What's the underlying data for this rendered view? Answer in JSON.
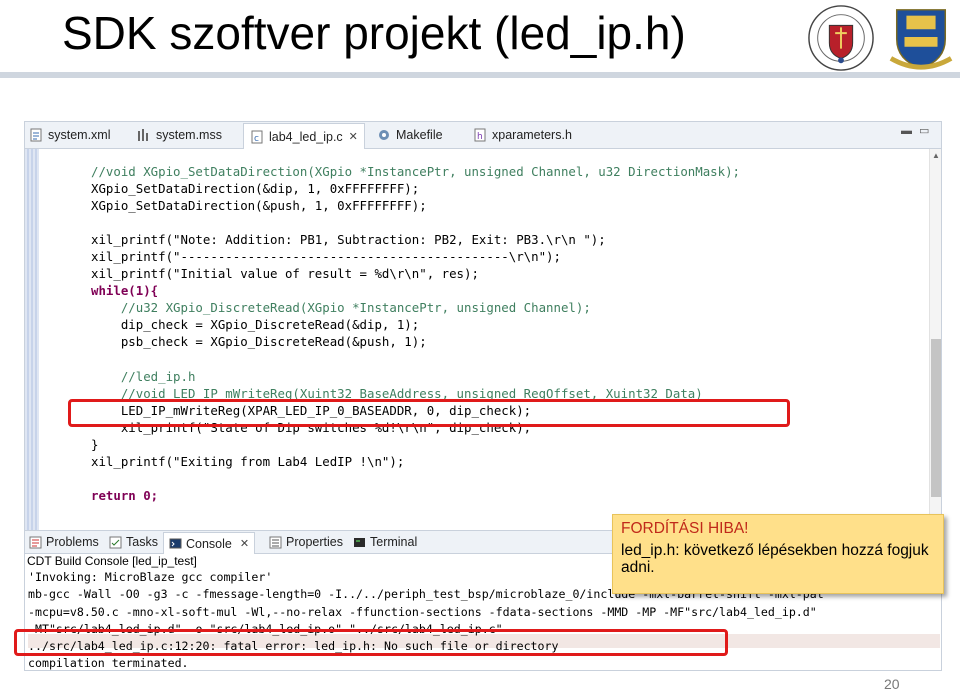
{
  "slide": {
    "title": "SDK szoftver projekt (led_ip.h)",
    "page_number": "20"
  },
  "editor": {
    "tabs": [
      {
        "label": "system.xml",
        "icon": "xml-file-icon"
      },
      {
        "label": "system.mss",
        "icon": "mss-file-icon"
      },
      {
        "label": "lab4_led_ip.c",
        "icon": "c-file-icon",
        "active": true
      },
      {
        "label": "Makefile",
        "icon": "makefile-icon"
      },
      {
        "label": "xparameters.h",
        "icon": "h-file-icon"
      }
    ],
    "code_lines": [
      "//void XGpio_SetDataDirection(XGpio *InstancePtr, unsigned Channel, u32 DirectionMask);",
      "XGpio_SetDataDirection(&dip, 1, 0xFFFFFFFF);",
      "XGpio_SetDataDirection(&push, 1, 0xFFFFFFFF);",
      "",
      "xil_printf(\"Note: Addition: PB1, Subtraction: PB2, Exit: PB3.\\r\\n \");",
      "xil_printf(\"--------------------------------------------\\r\\n\");",
      "xil_printf(\"Initial value of result = %d\\r\\n\", res);",
      "while(1){",
      "    //u32 XGpio_DiscreteRead(XGpio *InstancePtr, unsigned Channel);",
      "    dip_check = XGpio_DiscreteRead(&dip, 1);",
      "    psb_check = XGpio_DiscreteRead(&push, 1);",
      "",
      "    //led_ip.h",
      "    //void LED_IP_mWriteReg(Xuint32 BaseAddress, unsigned RegOffset, Xuint32 Data)",
      "    LED_IP_mWriteReg(XPAR_LED_IP_0_BASEADDR, 0, dip_check);",
      "    xil_printf(\"State of Dip switches %d!\\r\\n\", dip_check);",
      "}",
      "xil_printf(\"Exiting from Lab4 LedIP !\\n\");",
      "",
      "return 0;"
    ]
  },
  "bottom_panel": {
    "tabs": [
      {
        "label": "Problems",
        "icon": "problems-icon"
      },
      {
        "label": "Tasks",
        "icon": "tasks-icon"
      },
      {
        "label": "Console",
        "icon": "console-icon",
        "active": true
      },
      {
        "label": "Properties",
        "icon": "properties-icon"
      },
      {
        "label": "Terminal",
        "icon": "terminal-icon"
      }
    ],
    "console_title": "CDT Build Console [led_ip_test]",
    "console_lines": [
      "'Invoking: MicroBlaze gcc compiler'",
      "mb-gcc -Wall -O0 -g3 -c -fmessage-length=0 -I../../periph_test_bsp/microblaze_0/include -mxl-barrel-shift -mxl-pat",
      "-mcpu=v8.50.c -mno-xl-soft-mul -Wl,--no-relax -ffunction-sections -fdata-sections -MMD -MP -MF\"src/lab4_led_ip.d\"",
      "-MT\"src/lab4_led_ip.d\" -o \"src/lab4_led_ip.o\" \"../src/lab4_led_ip.c\"",
      "../src/lab4_led_ip.c:12:20: fatal error: led_ip.h: No such file or directory",
      "compilation terminated."
    ]
  },
  "callout": {
    "heading": "FORDÍTÁSI HIBA!",
    "text": "led_ip.h: következő lépésekben hozzá fogjuk adni."
  },
  "colors": {
    "highlight_border": "#e01a1a",
    "callout_bg": "#ffe08a",
    "callout_heading": "#c0291a",
    "comment": "#3f7f5f",
    "keyword": "#7f0055",
    "string": "#2a00ff"
  }
}
